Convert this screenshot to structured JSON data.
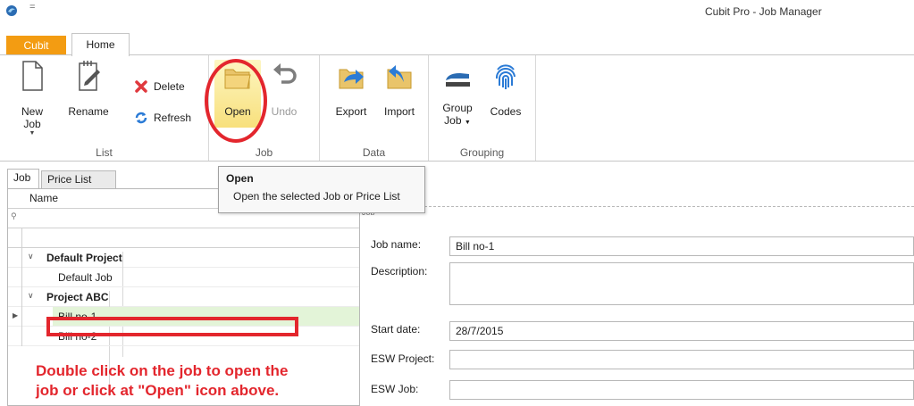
{
  "window": {
    "title": "Cubit Pro - Job Manager",
    "quick_access": "="
  },
  "ribbon_tabs": [
    {
      "label": "Cubit",
      "color": "#f39c12"
    },
    {
      "label": "Home"
    }
  ],
  "ribbon": {
    "list_group": {
      "label": "List",
      "new_job": "New Job",
      "rename": "Rename",
      "delete": "Delete",
      "refresh": "Refresh"
    },
    "job_group": {
      "label": "Job",
      "open": "Open",
      "undo": "Undo"
    },
    "data_group": {
      "label": "Data",
      "export": "Export",
      "import": "Import"
    },
    "grouping_group": {
      "label": "Grouping",
      "group_job_line1": "Group",
      "group_job_line2": "Job",
      "codes": "Codes"
    }
  },
  "tooltip": {
    "title": "Open",
    "description": "Open the selected Job or Price List"
  },
  "panel_tabs": [
    "Job",
    "Price List"
  ],
  "grid": {
    "column_name": "Name",
    "rows": [
      {
        "type": "group",
        "label": "Default Project"
      },
      {
        "type": "child",
        "label": "Default Job"
      },
      {
        "type": "group",
        "label": "Project ABC"
      },
      {
        "type": "child",
        "label": "Bill no-1",
        "selected": true
      },
      {
        "type": "child",
        "label": "Bill no-2"
      }
    ]
  },
  "annotation": {
    "line1": "Double click on the job to open the",
    "line2": "job or click at \"Open\" icon above.",
    "color": "#e3262d"
  },
  "form": {
    "section_label": "Job",
    "job_name_label": "Job name:",
    "job_name_value": "Bill no-1",
    "description_label": "Description:",
    "description_value": "",
    "start_date_label": "Start date:",
    "start_date_value": "28/7/2015",
    "esw_project_label": "ESW Project:",
    "esw_project_value": "",
    "esw_job_label": "ESW Job:",
    "esw_job_value": ""
  }
}
